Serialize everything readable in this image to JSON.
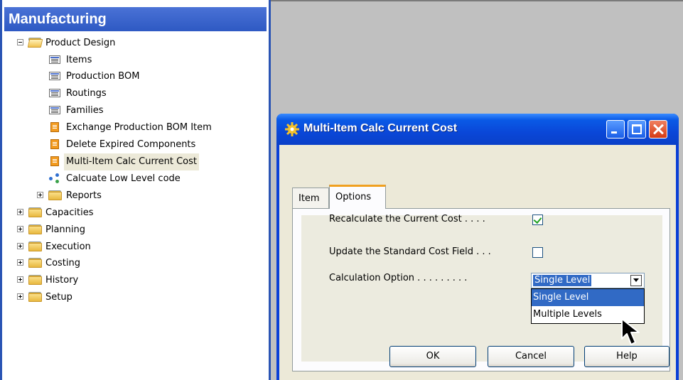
{
  "nav": {
    "title": "Manufacturing",
    "product_design": {
      "label": "Product Design",
      "items": [
        {
          "label": "Items",
          "icon": "list-icon"
        },
        {
          "label": "Production BOM",
          "icon": "list-icon"
        },
        {
          "label": "Routings",
          "icon": "list-icon"
        },
        {
          "label": "Families",
          "icon": "list-icon"
        },
        {
          "label": "Exchange Production BOM Item",
          "icon": "task-icon"
        },
        {
          "label": "Delete Expired Components",
          "icon": "task-icon"
        },
        {
          "label": "Multi-Item Calc Current Cost",
          "icon": "task-icon",
          "selected": true
        },
        {
          "label": "Calcuate Low Level code",
          "icon": "graph-icon"
        }
      ],
      "reports_label": "Reports"
    },
    "groups": [
      "Capacities",
      "Planning",
      "Execution",
      "Costing",
      "History",
      "Setup"
    ]
  },
  "dialog": {
    "title": "Multi-Item Calc Current Cost",
    "tabs": [
      "Item",
      "Options"
    ],
    "active_tab": "Options",
    "fields": {
      "recalc_label": "Recalculate the Current Cost . . . .",
      "recalc_checked": true,
      "update_std_label": "Update the Standard Cost Field . . .",
      "update_std_checked": false,
      "calc_option_label": "Calculation Option . . . . . . . . .",
      "calc_option_value": "Single Level",
      "calc_option_choices": [
        "Single Level",
        "Multiple Levels"
      ]
    },
    "buttons": {
      "ok": "OK",
      "cancel": "Cancel",
      "help": "Help"
    }
  },
  "colors": {
    "nav_title": "#2e59c3",
    "dialog_titlebar": "#0a47d8",
    "selection": "#316ac5",
    "tab_accent": "#f0a020",
    "workspace": "#c0c0c0"
  }
}
